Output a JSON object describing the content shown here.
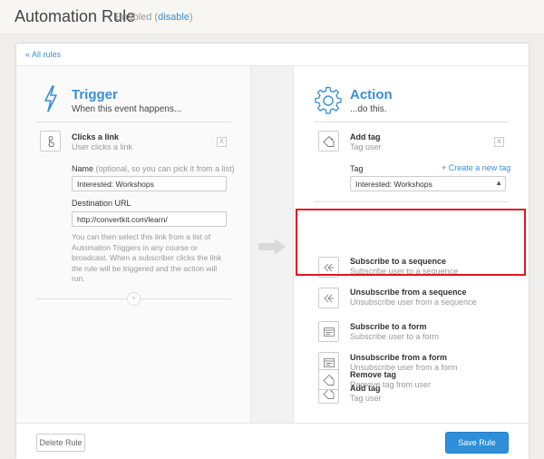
{
  "header": {
    "title": "Automation Rule",
    "status": "Enabled",
    "disable_label": "disable"
  },
  "nav": {
    "all_rules": "« All rules"
  },
  "trigger": {
    "title": "Trigger",
    "subtitle": "When this event happens...",
    "event": {
      "title": "Clicks a link",
      "subtitle": "User clicks a link",
      "remove": "X"
    },
    "name_label": "Name",
    "name_hint": "(optional, so you can pick it from a list)",
    "name_value": "Interested: Workshops",
    "url_label": "Destination URL",
    "url_value": "http://convertkit.com/learn/",
    "help_lines": [
      "You can then select this link from a list of",
      "Automation Triggers in any course or",
      "broadcast. When a subscriber clicks the link",
      "the rule will be triggered and the action will",
      "run."
    ],
    "add_plus": "+"
  },
  "action": {
    "title": "Action",
    "subtitle": "...do this.",
    "selected": {
      "title": "Add tag",
      "subtitle": "Tag user",
      "remove": "X"
    },
    "tag_label": "Tag",
    "create_tag": "+ Create a new tag",
    "tag_value": "Interested: Workshops",
    "options": [
      {
        "title": "Subscribe to a sequence",
        "subtitle": "Subscribe user to a sequence",
        "icon": "sequence-icon"
      },
      {
        "title": "Unsubscribe from a sequence",
        "subtitle": "Unsubscribe user from a sequence",
        "icon": "sequence-icon"
      },
      {
        "title": "Subscribe to a form",
        "subtitle": "Subscribe user to a form",
        "icon": "form-icon"
      },
      {
        "title": "Unsubscribe from a form",
        "subtitle": "Unsubscribe user from a form",
        "icon": "form-icon"
      },
      {
        "title": "Add tag",
        "subtitle": "Tag user",
        "icon": "tag-icon"
      },
      {
        "title": "Remove tag",
        "subtitle": "Remove tag from user",
        "icon": "tag-icon"
      }
    ]
  },
  "footer": {
    "delete_label": "Delete Rule",
    "save_label": "Save Rule"
  },
  "colors": {
    "accent": "#3a8fd4",
    "highlight": "#e1141e",
    "save_button": "#2f8fd8"
  }
}
